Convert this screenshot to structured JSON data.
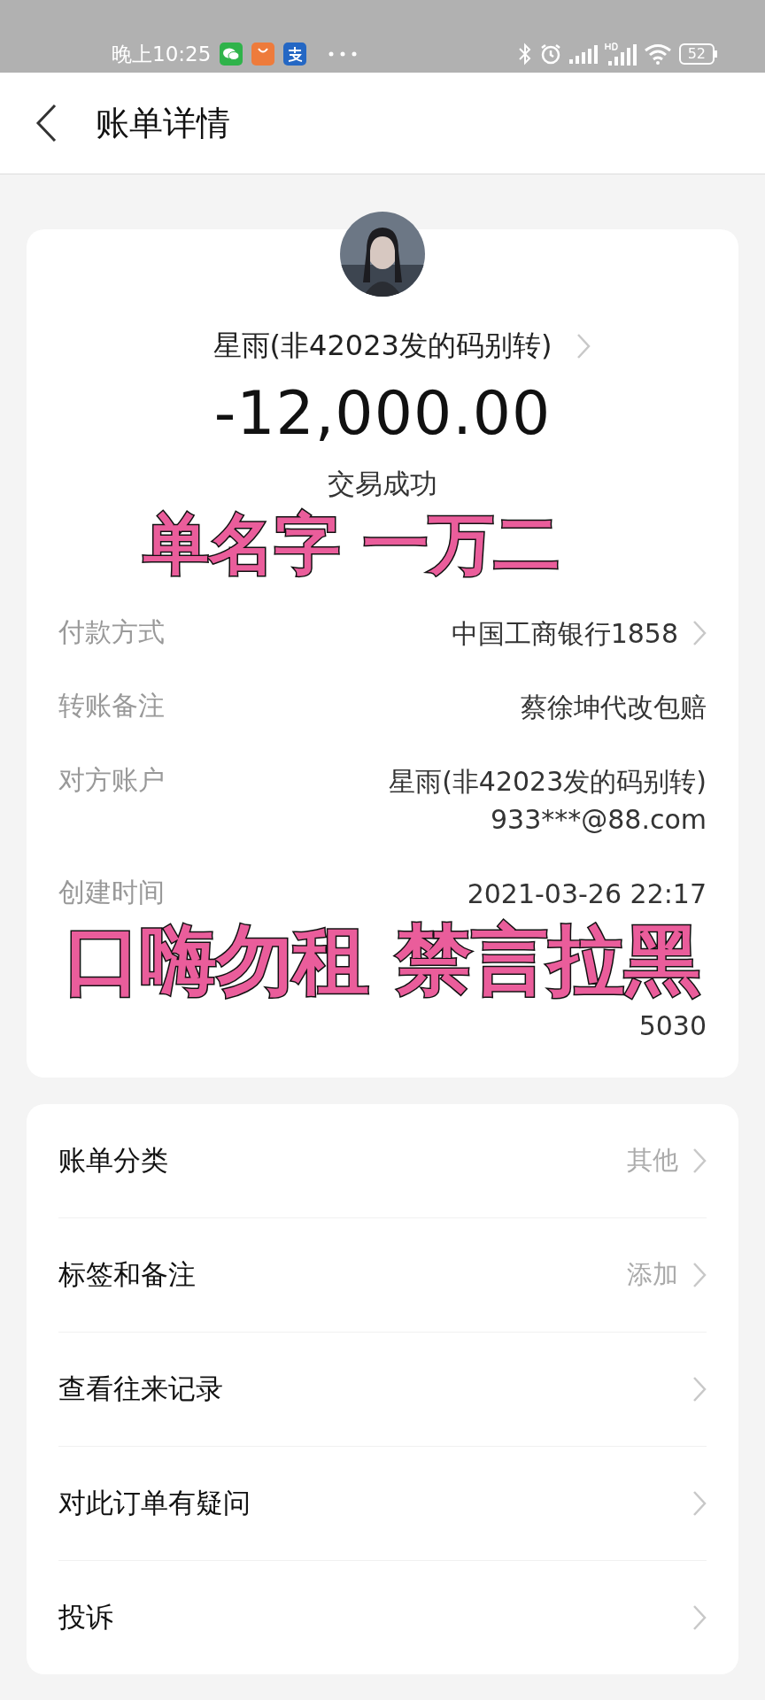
{
  "status_bar": {
    "time": "晚上10:25",
    "battery": "52"
  },
  "header": {
    "title": "账单详情"
  },
  "summary": {
    "name": "星雨(非42023发的码别转)",
    "amount": "-12,000.00",
    "status": "交易成功"
  },
  "details": [
    {
      "kind": "caption",
      "text": "单名字  一万二"
    },
    {
      "kind": "row",
      "label": "付款方式",
      "lines": [
        "中国工商银行1858"
      ],
      "link": true
    },
    {
      "kind": "row",
      "label": "转账备注",
      "lines": [
        "蔡徐坤代改包赔"
      ],
      "link": false
    },
    {
      "kind": "row",
      "label": "对方账户",
      "lines": [
        "星雨(非42023发的码别转)",
        "933***@88.com"
      ],
      "link": false
    },
    {
      "kind": "row",
      "label": "创建时间",
      "lines": [
        "2021-03-26 22:17"
      ],
      "link": false
    },
    {
      "kind": "caption",
      "text": "口嗨勿租 禁言拉黑"
    },
    {
      "kind": "row",
      "lines": [
        "5030"
      ],
      "link": false
    }
  ],
  "actions": [
    {
      "label": "账单分类",
      "value": "其他"
    },
    {
      "label": "标签和备注",
      "value": "添加"
    },
    {
      "label": "查看往来记录"
    },
    {
      "label": "对此订单有疑问"
    },
    {
      "label": "投诉"
    }
  ]
}
